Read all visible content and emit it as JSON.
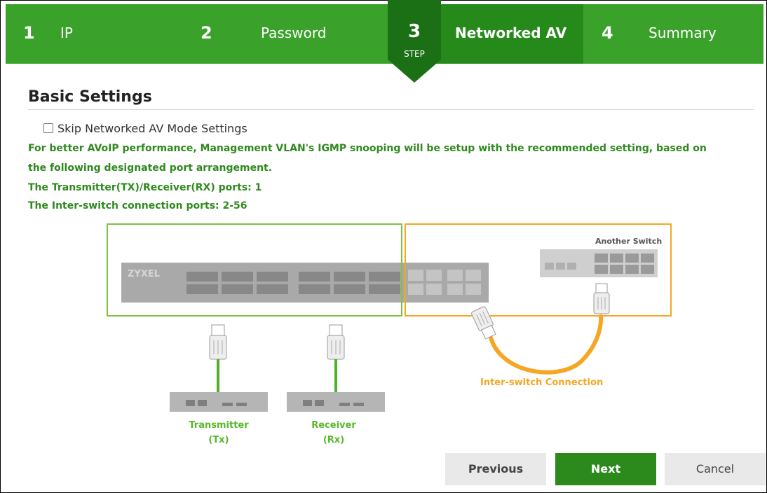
{
  "steps": [
    {
      "number": "1",
      "label": "IP"
    },
    {
      "number": "2",
      "label": "Password"
    },
    {
      "number": "3",
      "label": "Networked AV",
      "badge": "STEP"
    },
    {
      "number": "4",
      "label": "Summary"
    }
  ],
  "section": {
    "title": "Basic Settings"
  },
  "skip": {
    "label": "Skip Networked AV Mode Settings",
    "checked": false
  },
  "notes": {
    "line1": "For better AVoIP performance, Management VLAN's IGMP snooping will be setup with the recommended setting, based on",
    "line2": "the following designated port arrangement.",
    "line3": "The Transmitter(TX)/Receiver(RX) ports: 1",
    "line4": "The Inter-switch connection ports: 2-56"
  },
  "diagram": {
    "brand": "ZYXEL",
    "another_switch": "Another Switch",
    "inter_switch": "Inter-switch Connection",
    "transmitter": {
      "line1": "Transmitter",
      "line2": "(Tx)"
    },
    "receiver": {
      "line1": "Receiver",
      "line2": "(Rx)"
    }
  },
  "buttons": {
    "previous": "Previous",
    "next": "Next",
    "cancel": "Cancel"
  },
  "colors": {
    "step_green": "#3aa12a",
    "step_active": "#268a1b",
    "badge": "#1b6f14",
    "note_green": "#2f8a1e",
    "label_green": "#57b82b",
    "orange": "#f5a623",
    "next_button": "#2c8a1d"
  }
}
